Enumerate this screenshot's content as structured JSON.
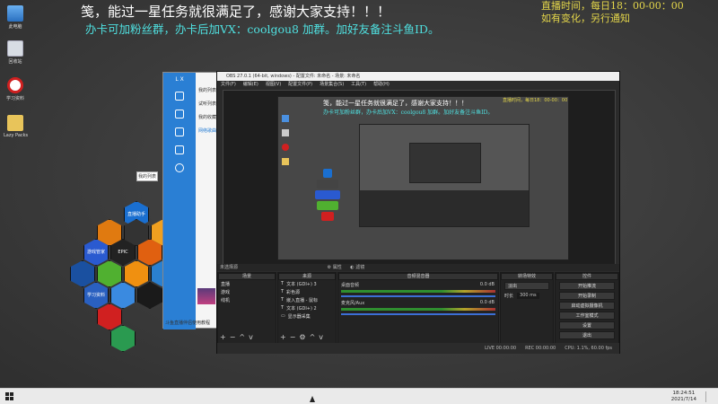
{
  "overlay": {
    "line1": "笺，能过一星任务就很满足了，感谢大家支持！！！",
    "line2": "办卡可加粉丝群，办卡后加VX：coolgou8 加群。加好友备注斗鱼ID。",
    "schedule_line1": "直播时间，每日18：00-00：00",
    "schedule_line2": "如有变化，另行通知"
  },
  "desktop_icons": [
    {
      "label": "此电脑",
      "icon": "computer-icon"
    },
    {
      "label": "回收站",
      "icon": "recycle-bin-icon"
    },
    {
      "label": "学习资料",
      "icon": "blocked-folder-icon"
    },
    {
      "label": "Lazy Packs",
      "icon": "folder-icon"
    }
  ],
  "dock_apps": [
    {
      "label": "直播助手",
      "color": "#1a6fd0"
    },
    {
      "label": "",
      "color": "#e07a10"
    },
    {
      "label": "",
      "color": "#333333"
    },
    {
      "label": "",
      "color": "#f0a020"
    },
    {
      "label": "游戏管家",
      "color": "#2a5ad0"
    },
    {
      "label": "EPIC",
      "color": "#222222"
    },
    {
      "label": "",
      "color": "#e06010"
    },
    {
      "label": "",
      "color": "#1a50a0"
    },
    {
      "label": "",
      "color": "#50b030"
    },
    {
      "label": "",
      "color": "#f09010"
    },
    {
      "label": "",
      "color": "#2a80d0"
    },
    {
      "label": "学习资料",
      "color": "#2a60c0"
    },
    {
      "label": "",
      "color": "#3a8ae0"
    },
    {
      "label": "",
      "color": "#1a1a1a"
    },
    {
      "label": "",
      "color": "#d02020"
    },
    {
      "label": "",
      "color": "#2a9a50"
    }
  ],
  "chat_app": {
    "title": "L X",
    "rows": [
      "我的列表",
      "试听列表",
      "我的收藏",
      "网络歌曲"
    ],
    "tooltip": "我的列表",
    "footer": "斗鱼直播伴侣使用教程"
  },
  "obs": {
    "title": "OBS 27.0.1 (64-bit, windows) - 配置文件: 未命名 - 场景: 未命名",
    "menu": [
      "文件(F)",
      "编辑(E)",
      "视图(V)",
      "配置文件(P)",
      "场景集合(S)",
      "工具(T)",
      "帮助(H)"
    ],
    "no_source": "未选择源",
    "props_label": "属性",
    "filters_label": "滤镜",
    "docks": {
      "scenes": "场景",
      "sources": "来源",
      "mixer": "音频混音器",
      "transitions": "转场特效",
      "controls": "控件"
    },
    "scenes": [
      "直播",
      "游戏",
      "线机"
    ],
    "sources": [
      "文本 (GDI+) 3",
      "彩色源",
      "嵌入直播 - 鼠标",
      "文本 (GDI+) 2",
      "显示器采集"
    ],
    "mixer": [
      {
        "name": "桌面音频",
        "level": "0.0 dB"
      },
      {
        "name": "麦克风/Aux",
        "level": "0.0 dB"
      }
    ],
    "transition": {
      "type": "淡出",
      "duration_label": "时长",
      "duration": "300 ms"
    },
    "controls": [
      "开始推流",
      "开始录制",
      "启动虚拟摄像机",
      "工作室模式",
      "设置",
      "退出"
    ],
    "status": {
      "live": "LIVE 00:00:00",
      "rec": "REC 00:00:00",
      "cpu": "CPU: 1.1%, 60.00 fps"
    }
  },
  "taskbar": {
    "time": "18:24:51",
    "date": "2021/7/14"
  }
}
